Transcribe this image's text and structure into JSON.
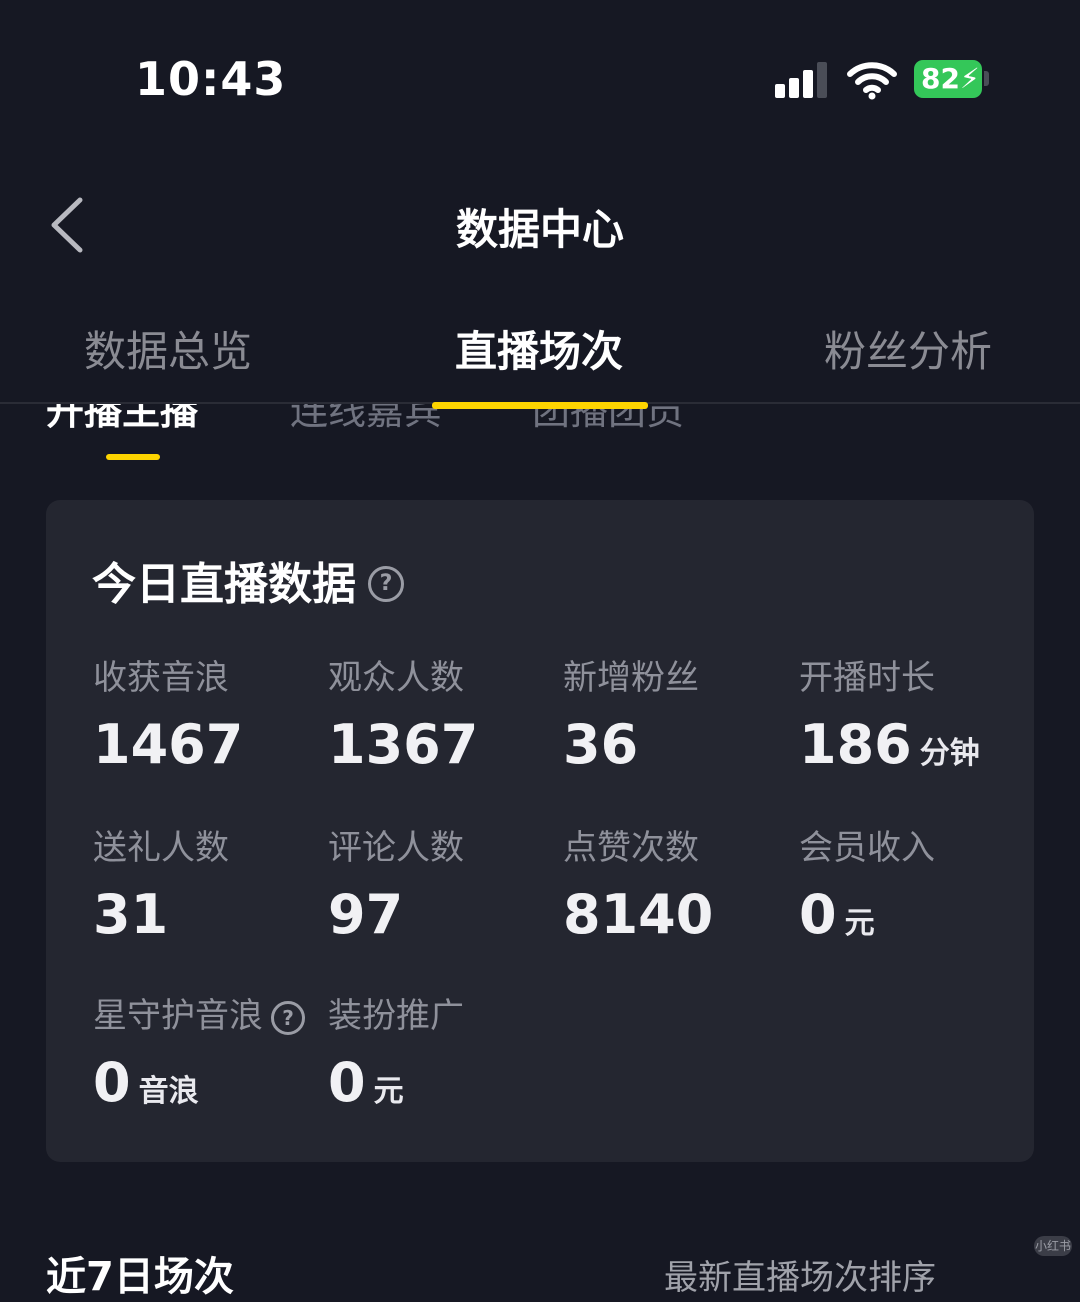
{
  "status_bar": {
    "time": "10:43",
    "battery": "82"
  },
  "header": {
    "title": "数据中心"
  },
  "main_tabs": [
    {
      "label": "数据总览"
    },
    {
      "label": "直播场次"
    },
    {
      "label": "粉丝分析"
    }
  ],
  "sub_tabs": [
    {
      "label": "开播主播"
    },
    {
      "label": "连线嘉宾"
    },
    {
      "label": "团播团员"
    }
  ],
  "card": {
    "title": "今日直播数据",
    "stats": [
      {
        "label": "收获音浪",
        "value": "1467",
        "unit": ""
      },
      {
        "label": "观众人数",
        "value": "1367",
        "unit": ""
      },
      {
        "label": "新增粉丝",
        "value": "36",
        "unit": ""
      },
      {
        "label": "开播时长",
        "value": "186",
        "unit": "分钟"
      },
      {
        "label": "送礼人数",
        "value": "31",
        "unit": ""
      },
      {
        "label": "评论人数",
        "value": "97",
        "unit": ""
      },
      {
        "label": "点赞次数",
        "value": "8140",
        "unit": ""
      },
      {
        "label": "会员收入",
        "value": "0",
        "unit": "元"
      },
      {
        "label": "星守护音浪",
        "value": "0",
        "unit": "音浪"
      },
      {
        "label": "装扮推广",
        "value": "0",
        "unit": "元"
      }
    ]
  },
  "bottom": {
    "left": "近7日场次",
    "right": "最新直播场次排序"
  },
  "colors": {
    "accent": "#fdd400",
    "battery": "#34c759",
    "background": "#161823",
    "card": "#242630"
  },
  "icons": [
    "back-chevron-icon",
    "help-circle-icon",
    "signal-icon",
    "wifi-icon",
    "battery-icon"
  ]
}
